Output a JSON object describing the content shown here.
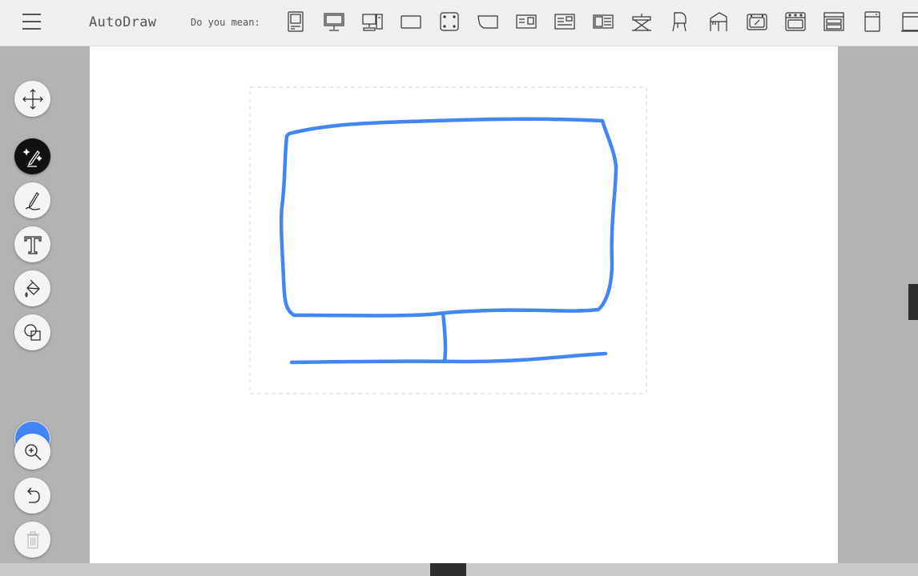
{
  "app": {
    "title": "AutoDraw",
    "suggestions_label": "Do you mean:"
  },
  "suggestions": [
    {
      "name": "computer-tower-icon"
    },
    {
      "name": "desktop-monitor-icon"
    },
    {
      "name": "desktop-computer-icon"
    },
    {
      "name": "rectangle-screen-icon"
    },
    {
      "name": "dice-icon"
    },
    {
      "name": "curved-screen-icon"
    },
    {
      "name": "id-card-icon"
    },
    {
      "name": "document-icon"
    },
    {
      "name": "postcard-icon"
    },
    {
      "name": "keyboard-stand-icon"
    },
    {
      "name": "piano-icon"
    },
    {
      "name": "grand-piano-icon"
    },
    {
      "name": "microwave-icon"
    },
    {
      "name": "oven-icon"
    },
    {
      "name": "stove-icon"
    },
    {
      "name": "refrigerator-icon"
    },
    {
      "name": "dishwasher-icon"
    }
  ],
  "tools": [
    {
      "name": "move-tool",
      "icon": "move-icon",
      "active": false
    },
    {
      "name": "autodraw-tool",
      "icon": "magic-pencil-icon",
      "active": true
    },
    {
      "name": "draw-tool",
      "icon": "pencil-icon",
      "active": false
    },
    {
      "name": "text-tool",
      "icon": "text-icon",
      "active": false
    },
    {
      "name": "fill-tool",
      "icon": "paint-bucket-icon",
      "active": false
    },
    {
      "name": "shape-tool",
      "icon": "shapes-icon",
      "active": false
    },
    {
      "name": "zoom-tool",
      "icon": "zoom-icon",
      "active": false
    },
    {
      "name": "undo-tool",
      "icon": "undo-icon",
      "active": false
    },
    {
      "name": "delete-tool",
      "icon": "trash-icon",
      "active": false
    }
  ],
  "colors": {
    "current_stroke": "#4285f4",
    "topbar_bg": "#efefef",
    "rail_bg": "#b3b3b3",
    "canvas_bg": "#ffffff",
    "active_tool_bg": "#111111"
  },
  "drawing": {
    "subject": "sketch of a computer monitor",
    "stroke_color": "#4285f4"
  }
}
